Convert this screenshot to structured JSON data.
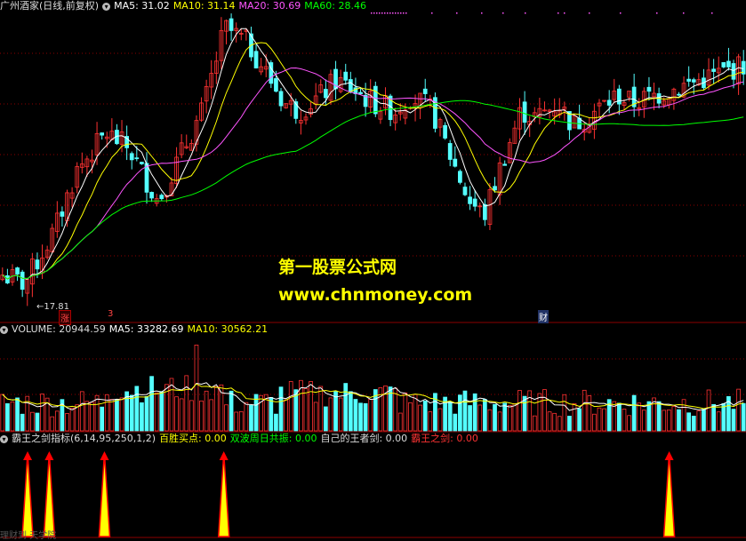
{
  "colors": {
    "up": "#ff3232",
    "down": "#54ffff",
    "ma5": "#ffffff",
    "ma10": "#ffff00",
    "ma20": "#ff55ff",
    "ma60": "#00ff00",
    "grid": "#8b0000",
    "label": "#cccccc",
    "signal": "#ffff00",
    "signal_edge": "#ff0000"
  },
  "main_panel": {
    "stock_name": "广州酒家(日线,前复权)",
    "ma5_label": "MA5: 31.02",
    "ma10_label": "MA10: 31.14",
    "ma20_label": "MA20: 30.69",
    "ma60_label": "MA60: 28.46",
    "low_label": "←17.81",
    "watermark_line1": "第一股票公式网",
    "watermark_line2": "www.chnmoney.com",
    "tag_zhang": "涨",
    "tag_3": "3",
    "tag_cai": "财"
  },
  "volume_panel": {
    "volume_label": "VOLUME: 20944.59",
    "ma5_label": "MA5: 33282.69",
    "ma10_label": "MA10: 30562.21"
  },
  "indicator_panel": {
    "name": "霸王之剑指标(6,14,95,250,1,2)",
    "item1": "百胜买点: 0.00",
    "item2": "双波周日共振: 0.00",
    "item3": "自己的王者剑: 0.00",
    "item4": "霸王之剑: 0.00"
  },
  "footer_text": "理财到 天学院",
  "chart_data": {
    "type": "candlestick",
    "price_panel": {
      "anchors_x": [
        0,
        0.03,
        0.07,
        0.1,
        0.14,
        0.17,
        0.21,
        0.25,
        0.27,
        0.3,
        0.33,
        0.35,
        0.38,
        0.4,
        0.43,
        0.45,
        0.47,
        0.5,
        0.53,
        0.55,
        0.58,
        0.6,
        0.63,
        0.65,
        0.67,
        0.7,
        0.72,
        0.75,
        0.77,
        0.8,
        0.83,
        0.85,
        0.88,
        0.91,
        0.94,
        0.97,
        1.0
      ],
      "anchors_close": [
        18.6,
        18.0,
        21.5,
        25.5,
        28.0,
        27.0,
        23.5,
        27.5,
        29.5,
        35.0,
        34.0,
        32.5,
        30.0,
        29.5,
        30.5,
        31.5,
        31.0,
        30.0,
        29.5,
        30.5,
        29.5,
        27.0,
        23.5,
        22.5,
        25.5,
        29.5,
        29.0,
        30.0,
        28.5,
        29.5,
        30.5,
        30.0,
        30.5,
        31.0,
        31.5,
        32.0,
        32.5
      ],
      "low_marker": 17.81,
      "ma_labels": {
        "MA5": 31.02,
        "MA10": 31.14,
        "MA20": 30.69,
        "MA60": 28.46
      }
    },
    "volume_panel": {
      "last_volume": 20944.59,
      "ma5": 33282.69,
      "ma10": 30562.21,
      "spike_at": 0.26,
      "spike_height": 0.92
    },
    "indicator_signals": [
      0.037,
      0.066,
      0.14,
      0.3,
      0.897
    ]
  }
}
